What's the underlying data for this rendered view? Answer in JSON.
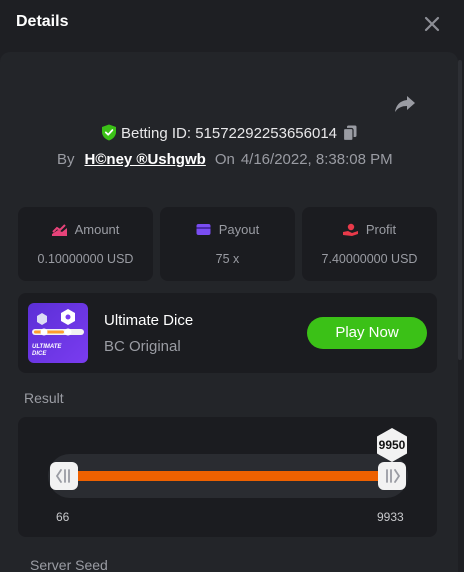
{
  "header": {
    "title": "Details"
  },
  "bet": {
    "label": "Betting ID:",
    "id": "51572292253656014",
    "by_label": "By",
    "user": "H©ney ®Ushgwb",
    "on_label": "On",
    "datetime": "4/16/2022, 8:38:08 PM"
  },
  "stats": [
    {
      "label": "Amount",
      "value": "0.10000000 USD",
      "icon": "amount-icon"
    },
    {
      "label": "Payout",
      "value": "75 x",
      "icon": "payout-card-icon"
    },
    {
      "label": "Profit",
      "value": "7.40000000 USD",
      "icon": "profit-hand-icon"
    }
  ],
  "game": {
    "name": "Ultimate Dice",
    "provider": "BC Original",
    "play_label": "Play Now",
    "thumb_text": "ULTIMATE DICE"
  },
  "result": {
    "label": "Result",
    "value": "9950",
    "range_min": "66",
    "range_max": "9933",
    "range_min_value": 66,
    "range_max_value": 9933,
    "result_value": 9950
  },
  "next_section": {
    "label": "Server Seed"
  },
  "colors": {
    "accent_green": "#3bc117",
    "track_orange": "#ee6100",
    "shield_green": "#3bc117",
    "amount_pink": "#e8437a",
    "payout_purple": "#7a4df2",
    "profit_red": "#e83a4a"
  }
}
